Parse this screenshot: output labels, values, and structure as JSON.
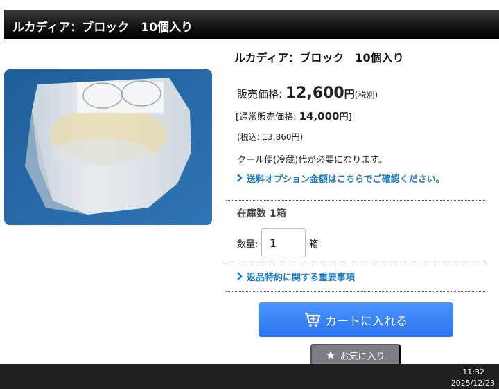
{
  "page": {
    "title_bar": "ルカディア：ブロック　10個入り"
  },
  "product": {
    "name": "ルカディア：ブロック　10個入り",
    "price_label": "販売価格:",
    "price_value": "12,600",
    "price_yen": "円",
    "price_tax_note": "(税別)",
    "regular_prefix": "[通常販売価格:",
    "regular_value": "14,000",
    "regular_yen": "円",
    "regular_suffix": "]",
    "tax_included": "(税込: 13,860円)",
    "cool_note": "クール便(冷蔵)代が必要になります。",
    "shipping_link": "送料オプション金額はこちらでご確認ください。",
    "stock": "在庫数 1箱",
    "qty_label": "数量:",
    "qty_value": "1",
    "qty_unit": "箱",
    "return_link": "返品特約に関する重要事項"
  },
  "actions": {
    "cart_button": "カートに入れる",
    "favorite_button": "お気に入り"
  },
  "taskbar": {
    "time": "11:32",
    "date": "2025/12/23"
  },
  "colors": {
    "link": "#1e7bc6",
    "cart_button": "#2f7bf0",
    "favorite_button": "#7d7d85"
  },
  "icons": {
    "cart": "cart-plus-icon",
    "favorite": "star-icon",
    "link": "chevron-right-icon"
  }
}
